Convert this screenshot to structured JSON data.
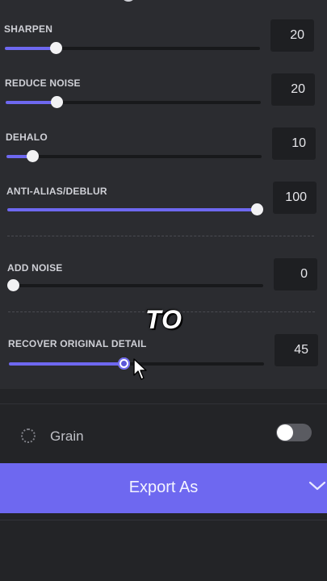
{
  "sliders": [
    {
      "label": "SHARPEN",
      "value": "20",
      "fraction": 0.2
    },
    {
      "label": "REDUCE NOISE",
      "value": "20",
      "fraction": 0.2
    },
    {
      "label": "DEHALO",
      "value": "10",
      "fraction": 0.1
    },
    {
      "label": "ANTI-ALIAS/DEBLUR",
      "value": "100",
      "fraction": 1.0
    },
    {
      "label": "ADD NOISE",
      "value": "0",
      "fraction": 0.0
    },
    {
      "label": "RECOVER ORIGINAL DETAIL",
      "value": "45",
      "fraction": 0.45
    }
  ],
  "overlay": {
    "caption": "TO"
  },
  "grain": {
    "label": "Grain",
    "enabled": false
  },
  "export": {
    "label": "Export As"
  },
  "colors": {
    "accent": "#6e68f0",
    "panel": "#2b2c30",
    "background": "#232427"
  }
}
